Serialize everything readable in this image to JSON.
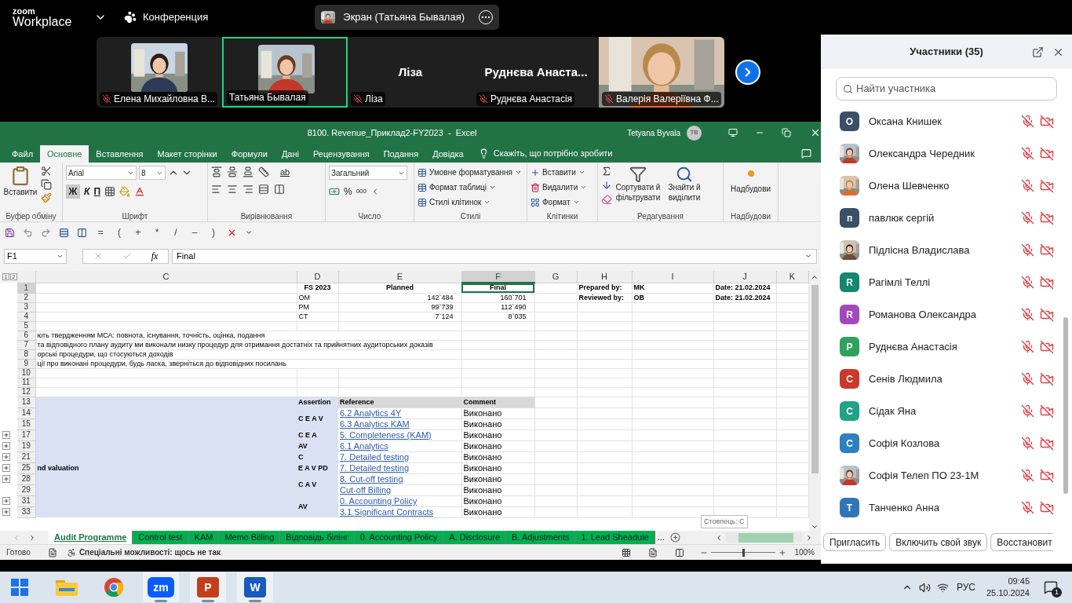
{
  "zoom_bar": {
    "logo_top": "zoom",
    "logo_bottom": "Workplace",
    "meeting": "Конференция",
    "share": "Экран (Татьяна Бывалая)"
  },
  "video_strip": {
    "tiles": [
      {
        "kind": "photo_small",
        "label": "Елена Михайловна В...",
        "muted": true,
        "selected": false
      },
      {
        "kind": "photo_small",
        "label": "Татьяна Бывалая",
        "muted": false,
        "selected": true
      },
      {
        "kind": "name_only",
        "big_name": "Ліза",
        "label": "Ліза",
        "muted": true,
        "selected": false
      },
      {
        "kind": "name_only",
        "big_name": "Руднєва Анаста...",
        "label": "Руднєва Анастасія",
        "muted": true,
        "selected": false
      },
      {
        "kind": "photo_full",
        "label": "Валерія Валеріївна Ф...",
        "muted": true,
        "selected": false
      }
    ]
  },
  "excel": {
    "title": "8100. Revenue_Приклад2-FY2023  -  Excel",
    "user": "Tetyana Byvala",
    "user_initials": "TB",
    "menu_tabs": [
      {
        "label": "Файл",
        "selected": false
      },
      {
        "label": "Основне",
        "selected": true
      },
      {
        "label": "Вставлення",
        "selected": false
      },
      {
        "label": "Макет сторінки",
        "selected": false
      },
      {
        "label": "Формули",
        "selected": false
      },
      {
        "label": "Дані",
        "selected": false
      },
      {
        "label": "Рецензування",
        "selected": false
      },
      {
        "label": "Подання",
        "selected": false
      },
      {
        "label": "Довідка",
        "selected": false
      }
    ],
    "tell_me": "Скажіть, що потрібно зробити",
    "ribbon": {
      "clipboard": {
        "label": "Буфер обміну",
        "paste": "Вставити"
      },
      "font": {
        "label": "Шрифт",
        "font": "Arial",
        "size": "8",
        "bold": "Ж",
        "italic": "К",
        "underline": "П"
      },
      "alignment": {
        "label": "Вирівнювання",
        "wrap": "ab"
      },
      "number": {
        "label": "Число",
        "format": "Загальний",
        "percent": "%",
        "thousands": "000"
      },
      "styles": {
        "label": "Стилі",
        "items": [
          "Умовне форматування",
          "Формат таблиці",
          "Стилі клітинок"
        ]
      },
      "cells": {
        "label": "Клітинки",
        "items": [
          "Вставити",
          "Видалити",
          "Формат"
        ]
      },
      "editing": {
        "label": "Редагування",
        "sort": "Сортувати й фільтрувати",
        "find": "Знайти й виділити"
      },
      "addins": {
        "label": "Надбудови",
        "button": "Надбудови"
      }
    },
    "quick_access_symbols": [
      "=",
      "(",
      "+",
      "*",
      "/",
      "–",
      ")"
    ],
    "name_box": "F1",
    "function_label": "fx",
    "formula": "Final",
    "outline_levels": [
      "1",
      "2"
    ],
    "columns": [
      {
        "label": "C",
        "selected": false
      },
      {
        "label": "D",
        "selected": false
      },
      {
        "label": "E",
        "selected": false
      },
      {
        "label": "F",
        "selected": true
      },
      {
        "label": "G",
        "selected": false
      },
      {
        "label": "H",
        "selected": false
      },
      {
        "label": "I",
        "selected": false
      },
      {
        "label": "J",
        "selected": false
      },
      {
        "label": "K",
        "selected": false
      }
    ],
    "rows": [
      {
        "number": "1",
        "selected": true,
        "expandable": false,
        "shaded": false,
        "cells": {
          "d": {
            "kind": "header",
            "text": "FS 2023"
          },
          "e": {
            "kind": "header",
            "text": "Planned"
          },
          "f": {
            "kind": "header",
            "text": "Final"
          },
          "h": {
            "kind": "label",
            "text": "Prepared by:"
          },
          "i": {
            "kind": "label",
            "text": "MK"
          },
          "j": {
            "kind": "label",
            "text": "Date: 21.02.2024"
          }
        }
      },
      {
        "number": "2",
        "selected": false,
        "expandable": false,
        "shaded": false,
        "cells": {
          "d": {
            "kind": "text",
            "text": "OM"
          },
          "e": {
            "kind": "number",
            "text": "142`484"
          },
          "f": {
            "kind": "number",
            "text": "160`701"
          },
          "h": {
            "kind": "label",
            "text": "Reviewed by:"
          },
          "i": {
            "kind": "label",
            "text": "OB"
          },
          "j": {
            "kind": "label",
            "text": "Date: 21.02.2024"
          }
        }
      },
      {
        "number": "3",
        "selected": false,
        "expandable": false,
        "shaded": false,
        "cells": {
          "d": {
            "kind": "text",
            "text": "PM"
          },
          "e": {
            "kind": "number",
            "text": "99`739"
          },
          "f": {
            "kind": "number",
            "text": "112`490"
          }
        }
      },
      {
        "number": "4",
        "selected": false,
        "expandable": false,
        "shaded": false,
        "cells": {
          "d": {
            "kind": "text",
            "text": "CT"
          },
          "e": {
            "kind": "number",
            "text": "7`124"
          },
          "f": {
            "kind": "number",
            "text": "8`035"
          }
        }
      },
      {
        "number": "5",
        "selected": false,
        "expandable": false,
        "shaded": false,
        "cells": {}
      },
      {
        "number": "6",
        "selected": false,
        "expandable": false,
        "shaded": false,
        "cells": {
          "c": {
            "kind": "note",
            "text": "ють твердженням МСА: повнота, існування, точність, оцінка, подання"
          }
        }
      },
      {
        "number": "7",
        "selected": false,
        "expandable": false,
        "shaded": false,
        "cells": {
          "c": {
            "kind": "note",
            "text": "та відповідного плану аудиту ми виконали низку процедур для отримання достатніх та прийнятних аудиторських доказів"
          }
        }
      },
      {
        "number": "8",
        "selected": false,
        "expandable": false,
        "shaded": false,
        "cells": {
          "c": {
            "kind": "note",
            "text": "орські процедури, що стосуються доходів"
          }
        }
      },
      {
        "number": "9",
        "selected": false,
        "expandable": false,
        "shaded": false,
        "cells": {
          "c": {
            "kind": "note",
            "text": "ції про виконані процедури, будь ласка, зверніться до відповідних посилань"
          }
        }
      },
      {
        "number": "10",
        "selected": false,
        "expandable": false,
        "shaded": false,
        "cells": {}
      },
      {
        "number": "11",
        "selected": false,
        "expandable": false,
        "shaded": false,
        "cells": {}
      },
      {
        "number": "12",
        "selected": false,
        "expandable": false,
        "shaded": false,
        "cells": {}
      },
      {
        "number": "13",
        "selected": false,
        "expandable": false,
        "shaded": true,
        "cells": {
          "d": {
            "kind": "label",
            "text": "Assertion"
          },
          "e": {
            "kind": "gray_header",
            "text": "Reference"
          },
          "f": {
            "kind": "gray_header",
            "text": "Comment"
          }
        }
      },
      {
        "number": "14",
        "selected": false,
        "expandable": false,
        "shaded": true,
        "cells": {
          "d": {
            "kind": "assertion",
            "text": "C E A V",
            "merged_down": true
          },
          "e": {
            "kind": "link",
            "text": "6.2 Analytics 4Y"
          },
          "f": {
            "kind": "status",
            "text": "Виконано"
          }
        }
      },
      {
        "number": "15",
        "selected": false,
        "expandable": false,
        "shaded": true,
        "cells": {
          "e": {
            "kind": "link",
            "text": "6.3 Analytics KAM"
          },
          "f": {
            "kind": "status",
            "text": "Виконано"
          }
        }
      },
      {
        "number": "17",
        "selected": false,
        "expandable": true,
        "shaded": true,
        "cells": {
          "d": {
            "kind": "assertion",
            "text": "C E A",
            "merged_down": false
          },
          "e": {
            "kind": "link",
            "text": "5. Completeness (KAM)"
          },
          "f": {
            "kind": "status",
            "text": "Виконано"
          }
        }
      },
      {
        "number": "19",
        "selected": false,
        "expandable": true,
        "shaded": true,
        "cells": {
          "d": {
            "kind": "assertion",
            "text": "AV",
            "merged_down": false
          },
          "e": {
            "kind": "link",
            "text": "6.1 Analytics"
          },
          "f": {
            "kind": "status",
            "text": "Виконано"
          }
        }
      },
      {
        "number": "21",
        "selected": false,
        "expandable": true,
        "shaded": true,
        "cells": {
          "d": {
            "kind": "assertion",
            "text": "C",
            "merged_down": false
          },
          "e": {
            "kind": "link",
            "text": "7. Detailed testing"
          },
          "f": {
            "kind": "status",
            "text": "Виконано"
          }
        }
      },
      {
        "number": "25",
        "selected": false,
        "expandable": true,
        "shaded": true,
        "cells": {
          "c": {
            "kind": "label",
            "text": "nd valuation"
          },
          "d": {
            "kind": "assertion",
            "text": "E A V PD",
            "merged_down": false
          },
          "e": {
            "kind": "link",
            "text": "7. Detailed testing"
          },
          "f": {
            "kind": "status",
            "text": "Виконано"
          }
        }
      },
      {
        "number": "28",
        "selected": false,
        "expandable": true,
        "shaded": true,
        "cells": {
          "d": {
            "kind": "assertion",
            "text": "C A V",
            "merged_down": true
          },
          "e": {
            "kind": "link",
            "text": "8. Cut-off testing"
          },
          "f": {
            "kind": "status",
            "text": "Виконано"
          }
        }
      },
      {
        "number": "29",
        "selected": false,
        "expandable": false,
        "shaded": true,
        "cells": {
          "e": {
            "kind": "link",
            "text": "Cut-off Billing"
          },
          "f": {
            "kind": "status",
            "text": "Виконано"
          }
        }
      },
      {
        "number": "31",
        "selected": false,
        "expandable": true,
        "shaded": true,
        "cells": {
          "d": {
            "kind": "assertion",
            "text": "AV",
            "merged_down": true
          },
          "e": {
            "kind": "link",
            "text": "0. Accounting Policy"
          },
          "f": {
            "kind": "status",
            "text": "Виконано"
          }
        }
      },
      {
        "number": "33",
        "selected": false,
        "expandable": true,
        "shaded": true,
        "cells": {
          "e": {
            "kind": "link",
            "text": "3.1 Significant Contracts"
          },
          "f": {
            "kind": "status",
            "text": "Виконано"
          }
        }
      }
    ],
    "sheet_tabs": [
      {
        "label": "Audit Programme",
        "selected": true
      },
      {
        "label": "Control test",
        "selected": false
      },
      {
        "label": "KAM",
        "selected": false
      },
      {
        "label": "Memo Billing",
        "selected": false
      },
      {
        "label": "Відповідь білінг",
        "selected": false
      },
      {
        "label": "0. Accounting Policy",
        "selected": false
      },
      {
        "label": "A. Disclosure",
        "selected": false
      },
      {
        "label": "B. Adjustments",
        "selected": false
      },
      {
        "label": "1. Lead Sheadule",
        "selected": false
      }
    ],
    "more_tabs": "...",
    "tooltip": "Стовпець: С",
    "status": {
      "ready": "Готово",
      "accessibility": "Спеціальні можливості: щось не так",
      "zoom": "100%",
      "zoom_slider": {
        "level": 0.5
      }
    }
  },
  "participants_panel": {
    "title": "Участники (35)",
    "search_placeholder": "Найти участника",
    "participants": [
      {
        "name": "Оксана Книшек",
        "avatar": {
          "kind": "letter",
          "letter": "О",
          "color": "#3b4f66"
        },
        "muted": true,
        "video_off": true
      },
      {
        "name": "Олександра Чередник",
        "muted": true,
        "video_off": true
      },
      {
        "name": "Олена Шевченко",
        "muted": true,
        "video_off": true
      },
      {
        "name": "павлюк сергій",
        "avatar": {
          "kind": "letter",
          "letter": "п",
          "color": "#3b4f66"
        },
        "muted": true,
        "video_off": true
      },
      {
        "name": "Підлісна Владислава",
        "muted": true,
        "video_off": true
      },
      {
        "name": "Рагімлі Теллі",
        "avatar": {
          "kind": "letter",
          "letter": "R",
          "color": "#13876f"
        },
        "muted": true,
        "video_off": true
      },
      {
        "name": "Романова Олександра",
        "avatar": {
          "kind": "letter",
          "letter": "R",
          "color": "#a348bd"
        },
        "muted": true,
        "video_off": true
      },
      {
        "name": "Руднєва Анастасія",
        "avatar": {
          "kind": "letter",
          "letter": "Р",
          "color": "#2fa35c"
        },
        "muted": true,
        "video_off": true
      },
      {
        "name": "Сенів Людмила",
        "avatar": {
          "kind": "letter",
          "letter": "С",
          "color": "#c9392c"
        },
        "muted": true,
        "video_off": true
      },
      {
        "name": "Сідак Яна",
        "avatar": {
          "kind": "letter",
          "letter": "С",
          "color": "#1fa286"
        },
        "muted": true,
        "video_off": true
      },
      {
        "name": "Софія Козлова",
        "avatar": {
          "kind": "letter",
          "letter": "С",
          "color": "#2f80c2"
        },
        "muted": true,
        "video_off": true
      },
      {
        "name": "Софія Телеп ПО 23-1М",
        "muted": true,
        "video_off": true
      },
      {
        "name": "Танченко Анна",
        "avatar": {
          "kind": "letter",
          "letter": "Т",
          "color": "#2f76b6"
        },
        "muted": true,
        "video_off": true
      }
    ],
    "buttons": [
      "Пригласить",
      "Включить свой звук",
      "Восстановит"
    ]
  },
  "taskbar": {
    "apps": [
      {
        "kind": "windows",
        "active": false
      },
      {
        "kind": "explorer",
        "active": false
      },
      {
        "kind": "chrome",
        "active": false
      },
      {
        "kind": "zoom",
        "label": "zm",
        "active": true
      },
      {
        "kind": "powerpoint",
        "label": "P",
        "active": true
      },
      {
        "kind": "word",
        "label": "W",
        "active": true
      }
    ],
    "language": "РУС",
    "time": "09:45",
    "date": "25.10.2024",
    "notifications": "1"
  }
}
